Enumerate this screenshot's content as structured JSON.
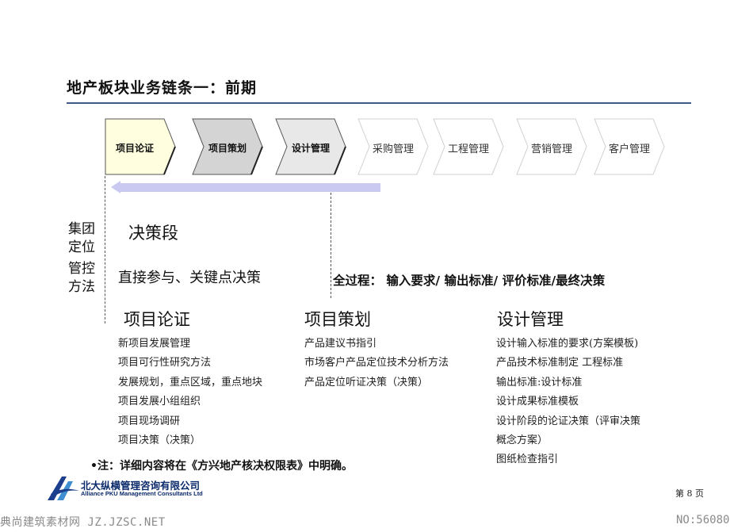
{
  "slide": {
    "title": "地产板块业务链条一：前期",
    "process_chain": [
      {
        "label": "项目论证",
        "fill": "#ffffe0",
        "style": "strong"
      },
      {
        "label": "项目策划",
        "fill": "#d4d4d4",
        "style": "strong"
      },
      {
        "label": "设计管理",
        "fill": "#e8e8e8",
        "style": "strong"
      },
      {
        "label": "采购管理",
        "fill": "#ffffff",
        "style": "faint"
      },
      {
        "label": "工程管理",
        "fill": "#ffffff",
        "style": "faint"
      },
      {
        "label": "营销管理",
        "fill": "#ffffff",
        "style": "faint"
      },
      {
        "label": "客户管理",
        "fill": "#ffffff",
        "style": "faint"
      }
    ],
    "arrow_color": "#c9c9f2",
    "side_label_1": [
      "集团",
      "定位"
    ],
    "side_label_2": [
      "管控",
      "方法"
    ],
    "stage_name": "决策段",
    "control_method": "直接参与、关键点决策",
    "full_process": "全过程： 输入要求/ 输出标准/ 评价标准/最终决策",
    "columns": [
      {
        "title": "项目论证",
        "items": [
          "新项目发展管理",
          "项目可行性研究方法",
          "发展规划，重点区域，重点地块",
          "项目发展小组组织",
          "项目现场调研",
          "项目决策（决策）"
        ]
      },
      {
        "title": "项目策划",
        "items": [
          "产品建议书指引",
          "市场客户产品定位技术分析方法",
          "产品定位听证决策（决策）"
        ]
      },
      {
        "title": "设计管理",
        "items": [
          "设计输入标准的要求(方案模板)",
          "产品技术标准制定 工程标准",
          "输出标准:设计标准",
          "设计成果标准模板",
          "设计阶段的论证决策（评审决策",
          "概念方案）",
          "图纸检查指引"
        ]
      }
    ],
    "note": "•注：详细内容将在《方兴地产核决权限表》中明确。",
    "company_cn": "北大纵横管理咨询有限公司",
    "company_en": "Alliance PKU Management Consultants Ltd",
    "page_label": "第 8 页"
  },
  "watermark": {
    "left": "典尚建筑素材网 JZ.JZSC.NET",
    "right": "NO:56080"
  }
}
